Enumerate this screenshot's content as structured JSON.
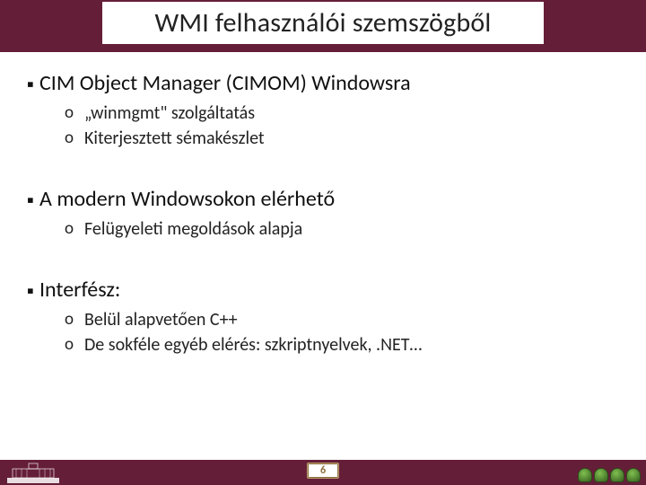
{
  "title": "WMI felhasználói szemszögből",
  "sections": [
    {
      "heading": "CIM Object Manager (CIMOM) Windowsra",
      "items": [
        "„winmgmt\" szolgáltatás",
        "Kiterjesztett sémakészlet"
      ]
    },
    {
      "heading": "A modern Windowsokon elérhető",
      "items": [
        "Felügyeleti megoldások alapja"
      ]
    },
    {
      "heading": "Interfész:",
      "items": [
        "Belül alapvetően C++",
        "De sokféle egyéb elérés: szkriptnyelvek, .NET…"
      ]
    }
  ],
  "page_number": "6",
  "colors": {
    "brand": "#651e38"
  }
}
